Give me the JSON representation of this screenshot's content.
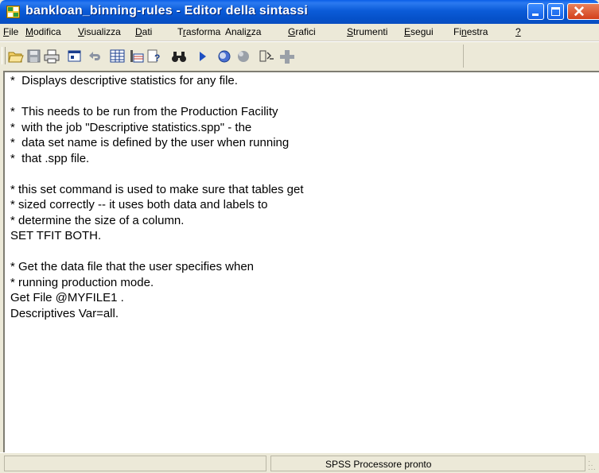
{
  "window": {
    "title": "bankloan_binning-rules - Editor della sintassi"
  },
  "menu": [
    {
      "pre": "",
      "u": "F",
      "post": "ile"
    },
    {
      "pre": "",
      "u": "M",
      "post": "odifica"
    },
    {
      "pre": "",
      "u": "V",
      "post": "isualizza"
    },
    {
      "pre": "",
      "u": "D",
      "post": "ati"
    },
    {
      "pre": "T",
      "u": "r",
      "post": "asforma"
    },
    {
      "pre": "Anali",
      "u": "z",
      "post": "za"
    },
    {
      "pre": "",
      "u": "G",
      "post": "rafici"
    },
    {
      "pre": "",
      "u": "S",
      "post": "trumenti"
    },
    {
      "pre": "",
      "u": "E",
      "post": "segui"
    },
    {
      "pre": "Fi",
      "u": "n",
      "post": "estra"
    },
    {
      "pre": "",
      "u": "?",
      "post": ""
    }
  ],
  "toolbar": {
    "icons": [
      "open-icon",
      "save-icon",
      "print-icon",
      "dialog-recall-icon",
      "undo-icon",
      "goto-data-icon",
      "variables-icon",
      "help-pointer-icon",
      "find-icon",
      "run-icon",
      "use-sets-icon",
      "show-all-icon",
      "syntax-help-icon",
      "insert-icon"
    ]
  },
  "editor": {
    "lines": [
      "*  Displays descriptive statistics for any file.",
      "",
      "*  This needs to be run from the Production Facility",
      "*  with the job \"Descriptive statistics.spp\" - the",
      "*  data set name is defined by the user when running",
      "*  that .spp file.",
      "",
      "* this set command is used to make sure that tables get",
      "* sized correctly -- it uses both data and labels to",
      "* determine the size of a column.",
      "SET TFIT BOTH.",
      "",
      "* Get the data file that the user specifies when",
      "* running production mode.",
      "Get File @MYFILE1 .",
      "Descriptives Var=all."
    ]
  },
  "status": {
    "text": "SPSS Processore pronto"
  },
  "colors": {
    "titlebar": "#0551c9",
    "close_button": "#d3401c",
    "chrome": "#ece9d8"
  }
}
